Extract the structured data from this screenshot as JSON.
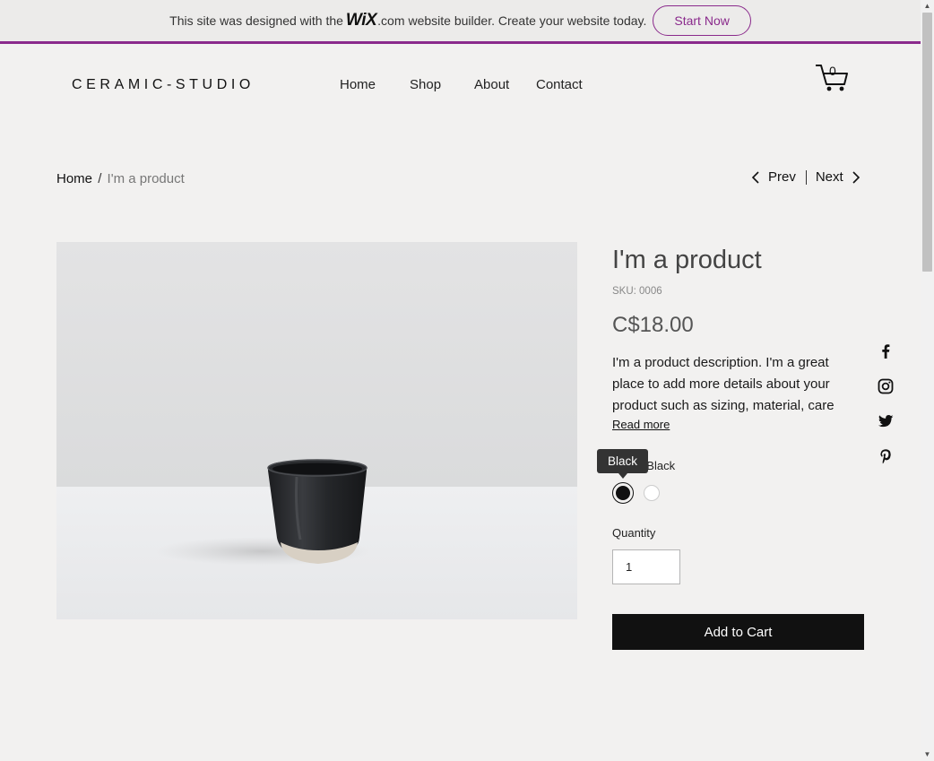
{
  "banner": {
    "text_before": "This site was designed with the",
    "wix": "WiX",
    "com": ".com",
    "text_after": "website builder. Create your website today.",
    "cta": "Start Now"
  },
  "header": {
    "logo": "CERAMIC-STUDIO",
    "nav": [
      "Home",
      "Shop",
      "About",
      "Contact"
    ],
    "cart_count": "0"
  },
  "breadcrumb": {
    "home": "Home",
    "separator": "/",
    "current": "I'm a product"
  },
  "pager": {
    "prev": "Prev",
    "next": "Next"
  },
  "product": {
    "title": "I'm a product",
    "sku": "SKU: 0006",
    "price": "C$18.00",
    "description": "I'm a product description. I'm a great place to add more details about your product such as sizing, material, care",
    "read_more": "Read more",
    "color_label": "Black",
    "color_tooltip": "Black",
    "colors": [
      "Black",
      "White"
    ],
    "quantity_label": "Quantity",
    "quantity_value": "1",
    "add_to_cart": "Add to Cart"
  },
  "social": [
    "facebook-icon",
    "instagram-icon",
    "twitter-icon",
    "pinterest-icon"
  ],
  "colors": {
    "accent": "#8a2a8c",
    "background": "#f2f1f0",
    "button": "#111111"
  }
}
